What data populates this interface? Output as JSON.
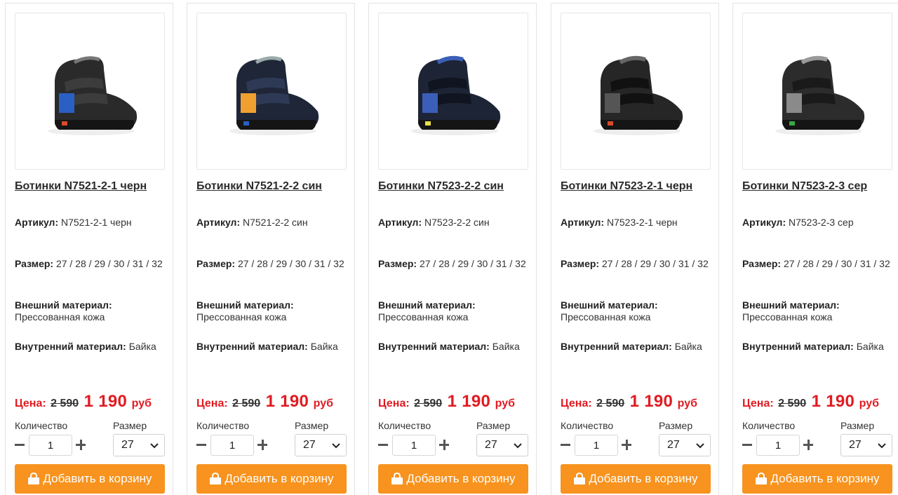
{
  "labels": {
    "article": "Артикул:",
    "size": "Размер:",
    "outer_material": "Внешний материал:",
    "inner_material": "Внутренний материал:",
    "price": "Цена:",
    "currency": "руб",
    "quantity": "Количество",
    "size_select": "Размер",
    "add_to_cart": "Добавить в корзину"
  },
  "colors": {
    "price_red": "#e11b22",
    "button_orange": "#f7931e"
  },
  "products": [
    {
      "title": "Ботинки N7521-2-1 черн",
      "article": "N7521-2-1 черн",
      "sizes": "27 / 28 / 29 / 30 / 31 / 32",
      "outer_material": "Прессованная кожа",
      "inner_material": "Байка",
      "old_price": "2 590",
      "new_price": "1 190",
      "quantity": "1",
      "selected_size": "27",
      "accent": "#2a5fc4",
      "accent2": "#d94a2a"
    },
    {
      "title": "Ботинки N7521-2-2 син",
      "article": "N7521-2-2 син",
      "sizes": "27 / 28 / 29 / 30 / 31 / 32",
      "outer_material": "Прессованная кожа",
      "inner_material": "Байка",
      "old_price": "2 590",
      "new_price": "1 190",
      "quantity": "1",
      "selected_size": "27",
      "accent": "#f0a030",
      "accent2": "#2a5fc4"
    },
    {
      "title": "Ботинки N7523-2-2 син",
      "article": "N7523-2-2 син",
      "sizes": "27 / 28 / 29 / 30 / 31 / 32",
      "outer_material": "Прессованная кожа",
      "inner_material": "Байка",
      "old_price": "2 590",
      "new_price": "1 190",
      "quantity": "1",
      "selected_size": "27",
      "accent": "#3b5fb8",
      "accent2": "#e8e04a"
    },
    {
      "title": "Ботинки N7523-2-1 черн",
      "article": "N7523-2-1 черн",
      "sizes": "27 / 28 / 29 / 30 / 31 / 32",
      "outer_material": "Прессованная кожа",
      "inner_material": "Байка",
      "old_price": "2 590",
      "new_price": "1 190",
      "quantity": "1",
      "selected_size": "27",
      "accent": "#555555",
      "accent2": "#d94a2a"
    },
    {
      "title": "Ботинки N7523-2-3 сер",
      "article": "N7523-2-3 сер",
      "sizes": "27 / 28 / 29 / 30 / 31 / 32",
      "outer_material": "Прессованная кожа",
      "inner_material": "Байка",
      "old_price": "2 590",
      "new_price": "1 190",
      "quantity": "1",
      "selected_size": "27",
      "accent": "#8a8a8a",
      "accent2": "#3aa845"
    }
  ]
}
